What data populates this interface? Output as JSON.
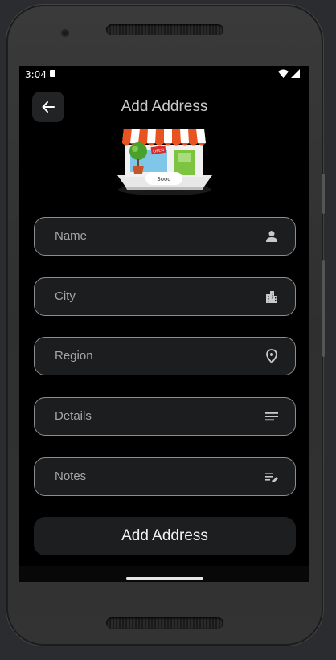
{
  "status_bar": {
    "time": "3:04"
  },
  "header": {
    "title": "Add Address"
  },
  "shop_image": {
    "sign_text": "Sooq",
    "awning_label": "OPEN"
  },
  "form": {
    "fields": [
      {
        "label": "Name",
        "icon": "person-icon"
      },
      {
        "label": "City",
        "icon": "city-icon"
      },
      {
        "label": "Region",
        "icon": "location-pin-icon"
      },
      {
        "label": "Details",
        "icon": "details-lines-icon"
      },
      {
        "label": "Notes",
        "icon": "edit-notes-icon"
      }
    ],
    "submit_label": "Add Address"
  },
  "colors": {
    "background": "#000000",
    "field_bg": "#1c1d1f",
    "field_border": "#8d8d8d",
    "button_bg": "#1d1e20"
  }
}
